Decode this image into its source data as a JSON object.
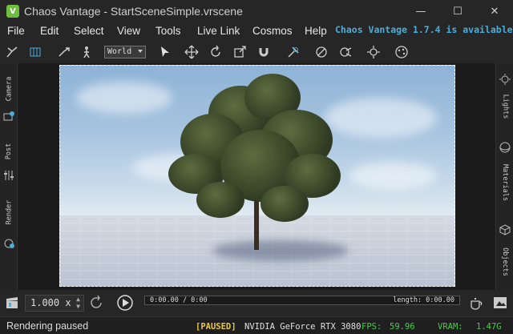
{
  "window": {
    "title": "Chaos Vantage - StartSceneSimple.vrscene",
    "app_icon": "vantage-logo-icon"
  },
  "menu": [
    "File",
    "Edit",
    "Select",
    "View",
    "Tools",
    "Live Link",
    "Cosmos",
    "Help"
  ],
  "notice": "Chaos Vantage 1.7.4 is available",
  "toolbar": {
    "space_dropdown": "World"
  },
  "left_tabs": [
    "Camera",
    "Post",
    "Render"
  ],
  "right_tabs": [
    "Lights",
    "Materials",
    "Objects"
  ],
  "playback": {
    "speed": "1.000 x",
    "time": "0:00.00 / 0:00",
    "length": "length: 0:00.00"
  },
  "status": {
    "message": "Rendering paused",
    "paused": "[PAUSED]",
    "gpu": "NVIDIA GeForce RTX 3080",
    "fps_label": "FPS:",
    "fps_value": "59.96",
    "vram_label": "VRAM:",
    "vram_value": "1.47G"
  },
  "colors": {
    "accent": "#4aaed8",
    "paused": "#e8c840",
    "fps": "#4cc94c"
  }
}
